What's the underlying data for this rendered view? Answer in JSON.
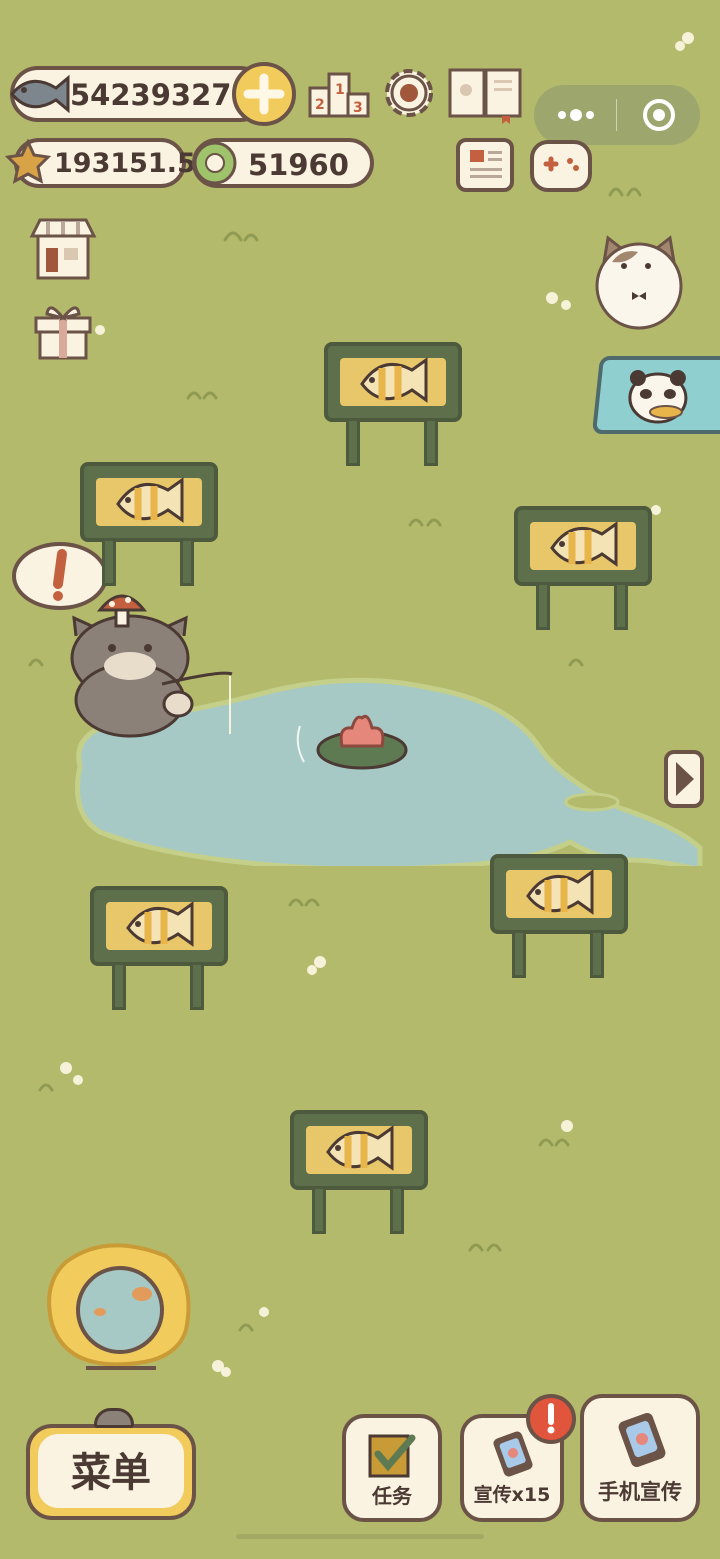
{
  "hud": {
    "fish_count": "54239327",
    "star_count": "193151.5",
    "ring_count": "51960"
  },
  "buttons": {
    "menu": "菜单",
    "tasks": "任务",
    "promote": "宣传x15",
    "phone_promote": "手机宣传"
  },
  "colors": {
    "grass": "#b4ba6b",
    "pond": "#a6c9c5",
    "border": "#6b5348",
    "cream": "#fbf3e2",
    "sign": "#5e6f4c",
    "fish_yellow": "#e7b54a",
    "alert": "#e0553b",
    "teal_banner": "#8fcfd0"
  },
  "icons": [
    "fish-icon",
    "plus-icon",
    "leaderboard-icon",
    "settings-gear-icon",
    "book-icon",
    "more-dots-icon",
    "target-icon",
    "star-icon",
    "ring-icon",
    "news-icon",
    "gamepad-icon",
    "shop-icon",
    "gift-icon",
    "exclamation-icon",
    "arrow-right-icon",
    "checklist-icon",
    "phone-icon"
  ]
}
